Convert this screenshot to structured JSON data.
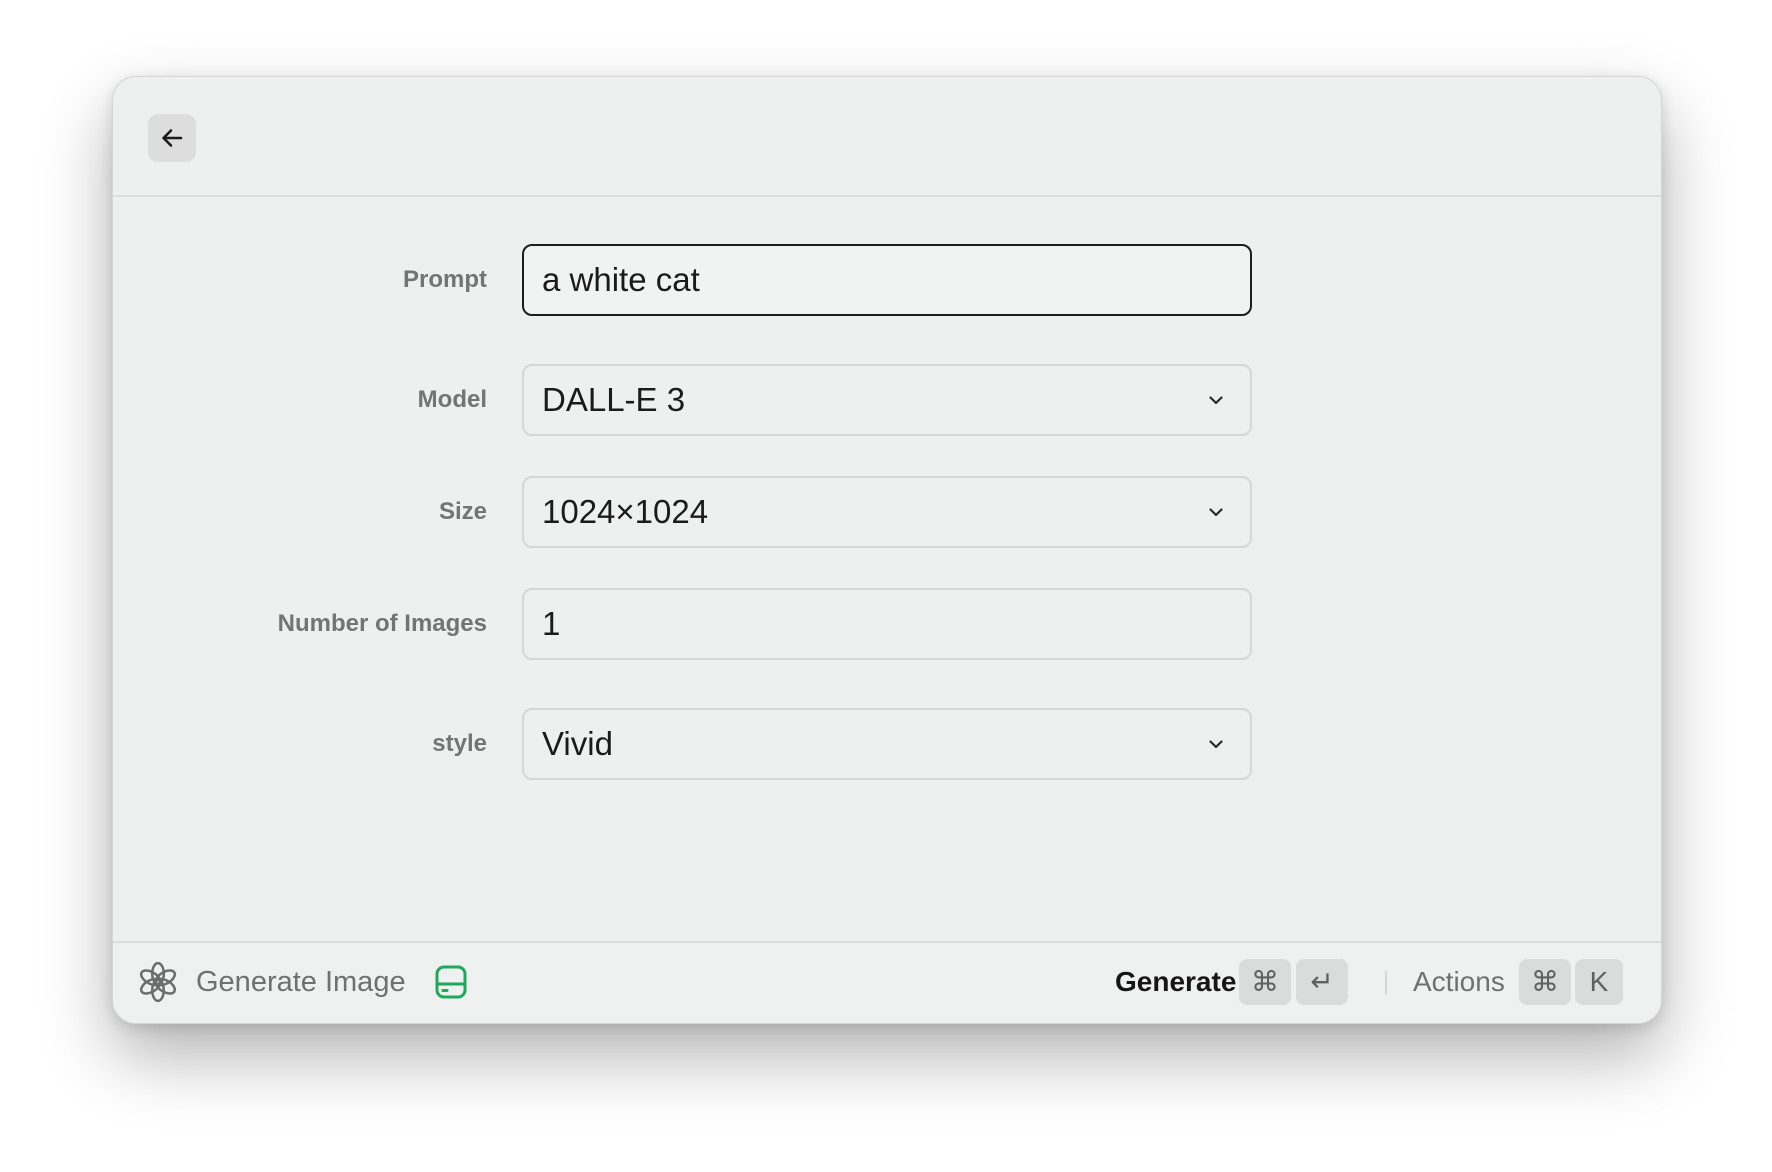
{
  "header": {
    "back_icon": "arrow-left-icon"
  },
  "form": {
    "prompt": {
      "label": "Prompt",
      "value": "a white cat"
    },
    "model": {
      "label": "Model",
      "value": "DALL-E 3"
    },
    "size": {
      "label": "Size",
      "value": "1024×1024"
    },
    "number_of_images": {
      "label": "Number of Images",
      "value": "1"
    },
    "style": {
      "label": "style",
      "value": "Vivid"
    }
  },
  "footer": {
    "app_icon": "openai-logo-icon",
    "title": "Generate Image",
    "storage_icon": "hard-drive-icon",
    "storage_icon_color": "#1ea85a",
    "primary_action": "Generate",
    "primary_shortcut": [
      "⌘",
      "↵"
    ],
    "secondary_action": "Actions",
    "secondary_shortcut": [
      "⌘",
      "K"
    ]
  },
  "colors": {
    "window_bg": "#eef0ef",
    "accent_green": "#1ea85a",
    "label_gray": "#737574",
    "text_dark": "#1b1b1b"
  }
}
